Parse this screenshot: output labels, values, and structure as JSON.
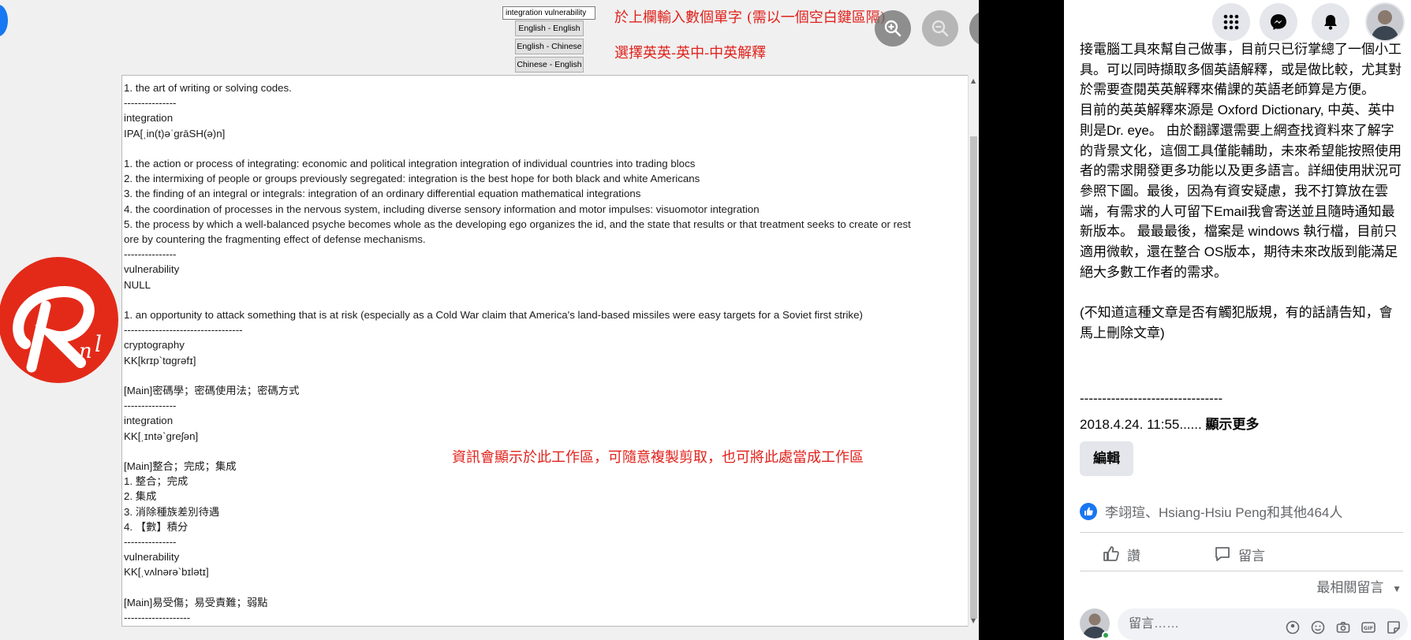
{
  "screenshot": {
    "word_input_value": "integration vulnerability",
    "mode_buttons": [
      "English - English",
      "English - Chinese",
      "Chinese - English"
    ],
    "note_input": "於上欄輸入數個單字 (需以一個空白鍵區隔)",
    "note_mode": "選擇英英-英中-中英解釋",
    "note_workarea": "資訊會顯示於此工作區，可隨意複製剪取，也可將此處當成工作區",
    "lines": [
      "1. the art of writing or solving codes.",
      "---------------",
      "integration",
      "IPA[ˌin(t)əˈɡrāSH(ə)n]",
      "",
      "1. the action or process of integrating: economic and political integration integration of individual countries into trading blocs",
      "2. the intermixing of people or groups previously segregated: integration is the best hope for both black and white Americans",
      "3. the finding of an integral or integrals: integration of an ordinary differential equation mathematical integrations",
      "4. the coordination of processes in the nervous system, including diverse sensory information and motor impulses: visuomotor integration",
      "5. the process by which a well-balanced psyche becomes whole as the developing ego organizes the id, and the state that results or that treatment seeks to create or rest",
      "ore by countering the fragmenting effect of defense mechanisms.",
      "---------------",
      "vulnerability",
      "NULL",
      "",
      "1. an opportunity to attack something that is at risk (especially as a Cold War claim that America's land-based missiles were easy targets for a Soviet first strike)",
      "----------------------------------",
      "cryptography",
      "KK[krɪp`tɑɡrəfɪ]",
      "",
      "[Main]密碼學；密碼使用法；密碼方式",
      "---------------",
      "integration",
      "KK[ˌɪntə`ɡreʃən]",
      "",
      "[Main]整合；完成；集成",
      "1. 整合；完成",
      "2. 集成",
      "3. 消除種族差別待遇",
      "4. 【數】積分",
      "---------------",
      "vulnerability",
      "KK[ˌvʌlnərə`bɪlətɪ]",
      "",
      "[Main]易受傷；易受責難；弱點",
      "-------------------"
    ]
  },
  "viewer_controls": {
    "zoom_in": "zoom-in-icon",
    "zoom_out": "zoom-out-icon",
    "tag": "tag-icon",
    "expand": "expand-icon"
  },
  "sidebar": {
    "post_paragraphs": [
      "接電腦工具來幫自己做事，目前只已衍掌總了一個小工具。可以同時擷取多個英語解釋，或是做比較，尤其對於需要查閱英英解釋來備課的英語老師算是方便。",
      "目前的英英解釋來源是 Oxford Dictionary, 中英、英中則是Dr. eye。 由於翻譯還需要上網查找資料來了解字的背景文化，這個工具僅能輔助，未來希望能按照使用者的需求開發更多功能以及更多語言。詳細使用狀況可參照下圖。最後，因為有資安疑慮，我不打算放在雲端，有需求的人可留下Email我會寄送並且隨時通知最新版本。 最最最後，檔案是 windows 執行檔，目前只適用微軟，還在整合 OS版本，期待未來改版到能滿足絕大多數工作者的需求。",
      "",
      "(不知道這種文章是否有觸犯版規，有的話請告知，會馬上刪除文章)"
    ],
    "divider": "--------------------------------",
    "date": "2018.4.24. 11:55......",
    "show_more": "顯示更多",
    "edit_label": "編輯",
    "likes_text": "李翊瑄、Hsiang-Hsiu Peng和其他464人",
    "like_label": "讚",
    "comment_label": "留言",
    "sort_label": "最相關留言",
    "comment_placeholder": "留言……",
    "colors": {
      "accent": "#1877f2",
      "red_note": "#e0221c",
      "logo_red": "#e32a19"
    }
  }
}
